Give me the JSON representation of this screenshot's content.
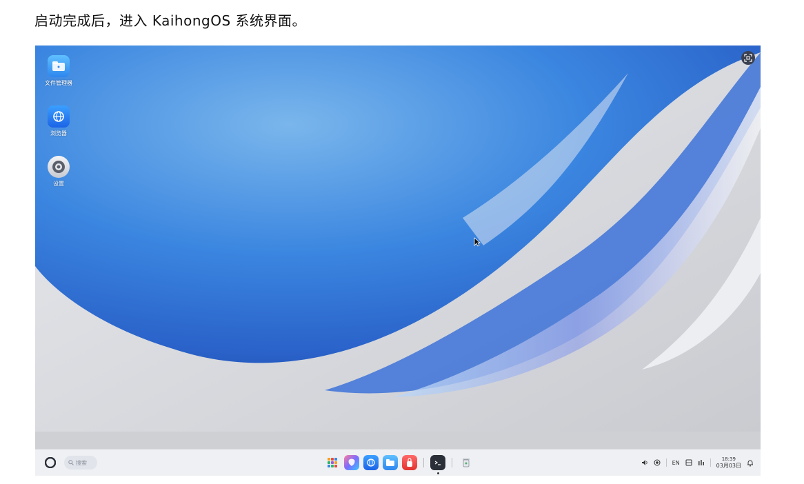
{
  "caption": "启动完成后，进入 KaihongOS 系统界面。",
  "desktop": {
    "icons": [
      {
        "label": "文件管理器",
        "icon": "folder-icon"
      },
      {
        "label": "浏览器",
        "icon": "globe-icon"
      },
      {
        "label": "设置",
        "icon": "gear-icon"
      }
    ]
  },
  "taskbar": {
    "search_placeholder": "搜索",
    "dock_apps": [
      "app-grid-icon",
      "assistant-icon",
      "browser-icon",
      "file-manager-icon",
      "store-icon",
      "terminal-icon",
      "trash-icon"
    ],
    "tray": {
      "input_method": "EN",
      "time": "18:39",
      "date": "03月03日"
    }
  },
  "colors": {
    "accent": "#2f7fe6",
    "taskbar_bg": "#eef0f3"
  }
}
